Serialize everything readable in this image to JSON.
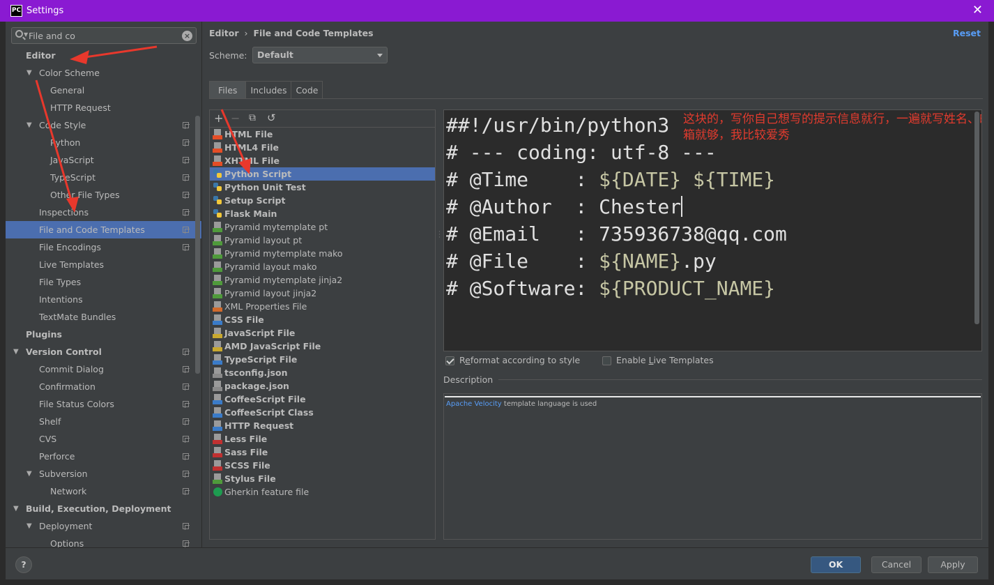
{
  "window": {
    "title": "Settings",
    "app_icon_text": "PC"
  },
  "search": {
    "value": "File and co"
  },
  "tree": [
    {
      "label": "Editor",
      "level": 0,
      "bold": true,
      "arrow": "",
      "proj": false
    },
    {
      "label": "Color Scheme",
      "level": 1,
      "bold": false,
      "arrow": "▼",
      "proj": false
    },
    {
      "label": "General",
      "level": 2,
      "bold": false,
      "arrow": "",
      "proj": false
    },
    {
      "label": "HTTP Request",
      "level": 2,
      "bold": false,
      "arrow": "",
      "proj": false
    },
    {
      "label": "Code Style",
      "level": 1,
      "bold": false,
      "arrow": "▼",
      "proj": true
    },
    {
      "label": "Python",
      "level": 2,
      "bold": false,
      "arrow": "",
      "proj": true
    },
    {
      "label": "JavaScript",
      "level": 2,
      "bold": false,
      "arrow": "",
      "proj": true
    },
    {
      "label": "TypeScript",
      "level": 2,
      "bold": false,
      "arrow": "",
      "proj": true
    },
    {
      "label": "Other File Types",
      "level": 2,
      "bold": false,
      "arrow": "",
      "proj": true
    },
    {
      "label": "Inspections",
      "level": 1,
      "bold": false,
      "arrow": "",
      "proj": true
    },
    {
      "label": "File and Code Templates",
      "level": 1,
      "bold": false,
      "arrow": "",
      "proj": true,
      "selected": true
    },
    {
      "label": "File Encodings",
      "level": 1,
      "bold": false,
      "arrow": "",
      "proj": true
    },
    {
      "label": "Live Templates",
      "level": 1,
      "bold": false,
      "arrow": "",
      "proj": false
    },
    {
      "label": "File Types",
      "level": 1,
      "bold": false,
      "arrow": "",
      "proj": false
    },
    {
      "label": "Intentions",
      "level": 1,
      "bold": false,
      "arrow": "",
      "proj": false
    },
    {
      "label": "TextMate Bundles",
      "level": 1,
      "bold": false,
      "arrow": "",
      "proj": false
    },
    {
      "label": "Plugins",
      "level": 0,
      "bold": true,
      "arrow": "",
      "proj": false
    },
    {
      "label": "Version Control",
      "level": 0,
      "bold": true,
      "arrow": "▼",
      "proj": true
    },
    {
      "label": "Commit Dialog",
      "level": 1,
      "bold": false,
      "arrow": "",
      "proj": true
    },
    {
      "label": "Confirmation",
      "level": 1,
      "bold": false,
      "arrow": "",
      "proj": true
    },
    {
      "label": "File Status Colors",
      "level": 1,
      "bold": false,
      "arrow": "",
      "proj": true
    },
    {
      "label": "Shelf",
      "level": 1,
      "bold": false,
      "arrow": "",
      "proj": true
    },
    {
      "label": "CVS",
      "level": 1,
      "bold": false,
      "arrow": "",
      "proj": true
    },
    {
      "label": "Perforce",
      "level": 1,
      "bold": false,
      "arrow": "",
      "proj": true
    },
    {
      "label": "Subversion",
      "level": 1,
      "bold": false,
      "arrow": "▼",
      "proj": true
    },
    {
      "label": "Network",
      "level": 2,
      "bold": false,
      "arrow": "",
      "proj": true
    },
    {
      "label": "Build, Execution, Deployment",
      "level": 0,
      "bold": true,
      "arrow": "▼",
      "proj": false
    },
    {
      "label": "Deployment",
      "level": 1,
      "bold": false,
      "arrow": "▼",
      "proj": true
    },
    {
      "label": "Options",
      "level": 2,
      "bold": false,
      "arrow": "",
      "proj": true
    }
  ],
  "header": {
    "breadcrumb_parent": "Editor",
    "breadcrumb_sep": "›",
    "breadcrumb_current": "File and Code Templates",
    "reset": "Reset"
  },
  "scheme": {
    "label": "Scheme:",
    "value": "Default"
  },
  "tabs": [
    "Files",
    "Includes",
    "Code"
  ],
  "toolbar": {
    "add": "+",
    "remove": "−",
    "copy": "⧉",
    "reset": "↺"
  },
  "templates": [
    {
      "name": "HTML File",
      "bold": true,
      "icon": "html",
      "tag_color": "#e44d26"
    },
    {
      "name": "HTML4 File",
      "bold": true,
      "icon": "html",
      "tag_color": "#e44d26"
    },
    {
      "name": "XHTML File",
      "bold": true,
      "icon": "html",
      "tag_color": "#e44d26"
    },
    {
      "name": "Python Script",
      "bold": true,
      "icon": "python",
      "selected": true
    },
    {
      "name": "Python Unit Test",
      "bold": true,
      "icon": "python"
    },
    {
      "name": "Setup Script",
      "bold": true,
      "icon": "python"
    },
    {
      "name": "Flask Main",
      "bold": true,
      "icon": "python"
    },
    {
      "name": "Pyramid mytemplate pt",
      "bold": false,
      "icon": "file",
      "tag_color": "#4f9a3b"
    },
    {
      "name": "Pyramid layout pt",
      "bold": false,
      "icon": "file",
      "tag_color": "#4f9a3b"
    },
    {
      "name": "Pyramid mytemplate mako",
      "bold": false,
      "icon": "file",
      "tag_color": "#4f9a3b"
    },
    {
      "name": "Pyramid layout mako",
      "bold": false,
      "icon": "file",
      "tag_color": "#4f9a3b"
    },
    {
      "name": "Pyramid mytemplate jinja2",
      "bold": false,
      "icon": "file",
      "tag_color": "#4f9a3b"
    },
    {
      "name": "Pyramid layout jinja2",
      "bold": false,
      "icon": "file",
      "tag_color": "#4f9a3b"
    },
    {
      "name": "XML Properties File",
      "bold": false,
      "icon": "file",
      "tag_color": "#d06a2c"
    },
    {
      "name": "CSS File",
      "bold": true,
      "icon": "file",
      "tag_color": "#3a7bc8"
    },
    {
      "name": "JavaScript File",
      "bold": true,
      "icon": "file",
      "tag_color": "#c8a82f"
    },
    {
      "name": "AMD JavaScript File",
      "bold": true,
      "icon": "file",
      "tag_color": "#c8a82f"
    },
    {
      "name": "TypeScript File",
      "bold": true,
      "icon": "file",
      "tag_color": "#3a7bc8"
    },
    {
      "name": "tsconfig.json",
      "bold": true,
      "icon": "file",
      "tag_color": "#8a8a8a"
    },
    {
      "name": "package.json",
      "bold": true,
      "icon": "file",
      "tag_color": "#8a8a8a"
    },
    {
      "name": "CoffeeScript File",
      "bold": true,
      "icon": "file",
      "tag_color": "#3a7bc8"
    },
    {
      "name": "CoffeeScript Class",
      "bold": true,
      "icon": "file",
      "tag_color": "#3a7bc8"
    },
    {
      "name": "HTTP Request",
      "bold": true,
      "icon": "file",
      "tag_color": "#3a7bc8"
    },
    {
      "name": "Less File",
      "bold": true,
      "icon": "file",
      "tag_color": "#c03030"
    },
    {
      "name": "Sass File",
      "bold": true,
      "icon": "file",
      "tag_color": "#c03030"
    },
    {
      "name": "SCSS File",
      "bold": true,
      "icon": "file",
      "tag_color": "#c03030"
    },
    {
      "name": "Stylus File",
      "bold": true,
      "icon": "file",
      "tag_color": "#4f9a3b"
    },
    {
      "name": "Gherkin feature file",
      "bold": false,
      "icon": "gherkin"
    }
  ],
  "editor": {
    "lines": [
      [
        {
          "t": "##!/usr/bin/python3",
          "c": ""
        }
      ],
      [
        {
          "t": "# --- coding: utf-8 ---",
          "c": ""
        }
      ],
      [
        {
          "t": "# @Time    : ",
          "c": ""
        },
        {
          "t": "${DATE}",
          "c": "var"
        },
        {
          "t": " ",
          "c": ""
        },
        {
          "t": "${TIME}",
          "c": "var"
        }
      ],
      [
        {
          "t": "# @Author  : Chester",
          "c": ""
        }
      ],
      [
        {
          "t": "# @Email   : 735936738@qq.com",
          "c": ""
        }
      ],
      [
        {
          "t": "# @File    : ",
          "c": ""
        },
        {
          "t": "${NAME}",
          "c": "var"
        },
        {
          "t": ".py",
          "c": ""
        }
      ],
      [
        {
          "t": "# @Software: ",
          "c": ""
        },
        {
          "t": "${PRODUCT_NAME}",
          "c": "var"
        }
      ]
    ],
    "caret_line": 3,
    "annotation": "这块的，写你自己想写的提示信息就行，一遍就写姓名、邮箱就够，我比较爱秀"
  },
  "options": {
    "reformat_pre": "R",
    "reformat_ul": "e",
    "reformat_post": "format according to style",
    "reformat_checked": true,
    "live_pre": "Enable ",
    "live_ul": "L",
    "live_post": "ive Templates",
    "live_checked": false
  },
  "description": {
    "title": "Description",
    "link": "Apache Velocity",
    "text": " template language is used"
  },
  "buttons": {
    "help": "?",
    "ok": "OK",
    "cancel": "Cancel",
    "apply": "Apply"
  },
  "colors": {
    "accent": "#8a1ad2",
    "selection": "#4b6eaf",
    "link": "#589df6",
    "annotation": "#e23b2e"
  }
}
